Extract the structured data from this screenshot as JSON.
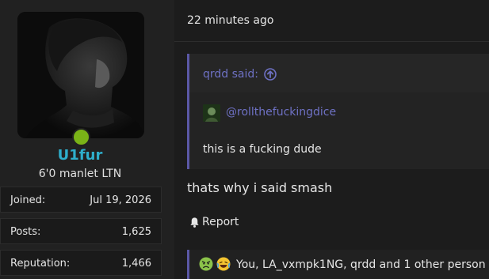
{
  "user": {
    "name": "U1fur",
    "title": "6'0 manlet LTN",
    "stats": [
      {
        "label": "Joined:",
        "value": "Jul 19, 2026"
      },
      {
        "label": "Posts:",
        "value": "1,625"
      },
      {
        "label": "Reputation:",
        "value": "1,466"
      }
    ],
    "online_color": "#7ab317"
  },
  "post": {
    "time": "22 minutes ago",
    "quote": {
      "author_label": "qrdd said:",
      "embed_mention": "@rollthefuckingdice",
      "text": "this is a fucking dude"
    },
    "body": "thats why i said smash",
    "report_label": "Report",
    "reactions": {
      "icons": [
        "angry-face-icon",
        "laughing-face-icon"
      ],
      "text": "You, LA_vxmpk1NG, qrdd and 1 other person"
    }
  },
  "colors": {
    "username": "#2eaecb",
    "link": "#6e71c4",
    "quote_bar": "#5b58a6"
  }
}
